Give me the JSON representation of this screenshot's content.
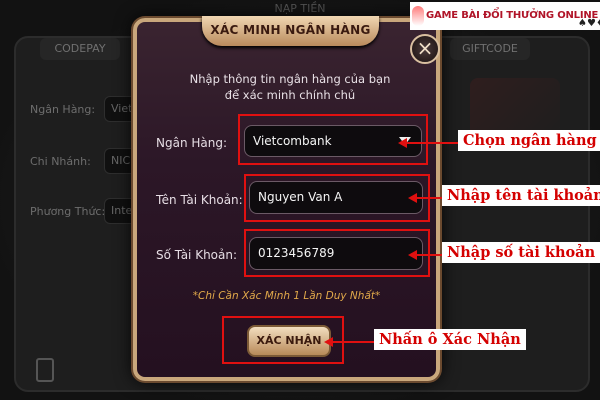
{
  "background": {
    "title": "NẠP TIỀN",
    "tabs": [
      "CODEPAY",
      "GIFTCODE"
    ],
    "labels": [
      "Ngân Hàng:",
      "Chi Nhánh:",
      "Phương Thức:"
    ],
    "fields": [
      "Vietc",
      "NICEP",
      "Intern"
    ]
  },
  "dialog": {
    "title": "XÁC MINH NGÂN HÀNG",
    "close_label": "×",
    "description_line1": "Nhập thông tin ngân hàng của bạn",
    "description_line2": "để xác minh chính chủ",
    "bank_label": "Ngân Hàng:",
    "bank_value": "Vietcombank",
    "account_name_label": "Tên Tài Khoản:",
    "account_name_value": "Nguyen Van A",
    "account_number_label": "Số Tài Khoản:",
    "account_number_value": "0123456789",
    "note": "*Chỉ Cần Xác Minh 1 Lần Duy Nhất*",
    "confirm_label": "XÁC NHẬN"
  },
  "annotations": {
    "choose_bank": "Chọn ngân hàng",
    "enter_name": "Nhập tên tài khoản",
    "enter_number": "Nhập số tài khoản",
    "press_confirm": "Nhấn ô Xác Nhận"
  },
  "watermark": {
    "text": "GAME BÀI ĐỔI THƯỞNG ONLINE",
    "suits": "♠♥♦♣"
  },
  "colors": {
    "annotation_red": "#e01010",
    "dialog_border": "#c9a77c",
    "note_color": "#e0a84a"
  }
}
